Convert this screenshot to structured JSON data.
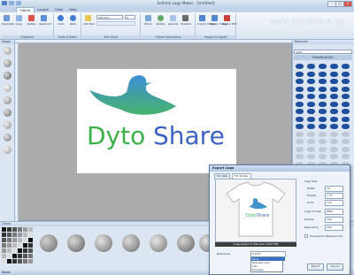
{
  "window": {
    "title": "Sothink Logo Maker - [Untitled]",
    "min_label": "–",
    "max_label": "□",
    "close_label": "×"
  },
  "tabs": [
    "Home",
    "Layout",
    "View",
    "Help"
  ],
  "ribbon": {
    "groups": [
      {
        "label": "Clipboard",
        "buttons": [
          "Duplicate",
          "Copy",
          "Delete",
          "Select All"
        ]
      },
      {
        "label": "Undo & Redo",
        "buttons": [
          "Undo",
          "Redo"
        ]
      },
      {
        "label": "Text Style",
        "font": "Tahoma",
        "size": "9",
        "buttons": [
          "Add Text"
        ]
      },
      {
        "label": "Object Operations",
        "buttons": [
          "Mirror",
          "Rotate",
          "Opacity",
          "Shadow"
        ]
      },
      {
        "label": "Import & Export",
        "buttons": [
          "Import Image",
          "Export Image",
          "Export PDF"
        ]
      }
    ]
  },
  "watermark": "www.dytoshare.us",
  "left_panel": {
    "header": "Shape"
  },
  "right_panel": {
    "header": "Resource",
    "search_value": "bub",
    "category": "Predefined Bar"
  },
  "logo": {
    "word1": "Dyto",
    "word2": "Share",
    "colors": {
      "green": "#3cb14a",
      "blue": "#3d63c4"
    }
  },
  "colors_panel": {
    "header": "Colors"
  },
  "status": "Ready",
  "dialog": {
    "title": "Export Logo",
    "tabs": [
      "For Web",
      "For Printer"
    ],
    "caption": "Image Ready  For Web (size: 1024*768)",
    "labels": {
      "size": "Logo Size",
      "width": "Width",
      "height": "Height",
      "units": "Units",
      "format": "Logo Format",
      "quality": "Quality",
      "resolution": "Resolution",
      "transparent": "Transparent Background",
      "reference": "Reference"
    },
    "values": {
      "width": "10",
      "height": "7.77",
      "units": "inch",
      "format": "JPEG",
      "quality": "100",
      "resolution": "300",
      "reference": "T-shirt"
    },
    "dropdown_options": [
      "None",
      "Business Card",
      "Cap",
      "Envelope"
    ],
    "buttons": {
      "export": "Export",
      "cancel": "Cancel"
    }
  }
}
